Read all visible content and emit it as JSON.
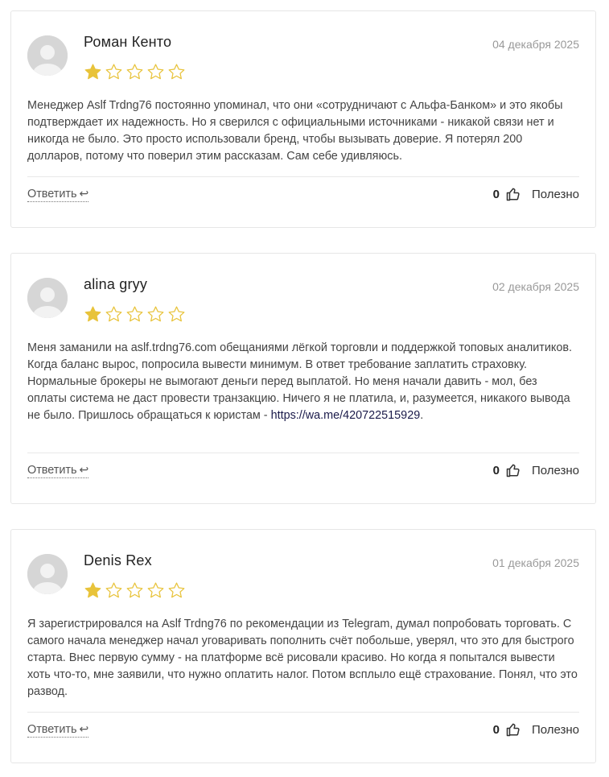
{
  "reviews": [
    {
      "author": "Роман Кенто",
      "date": "04 декабря 2025",
      "rating": 1,
      "max_rating": 5,
      "text": "Менеджер Aslf Trdng76 постоянно упоминал, что они «сотрудничают с Альфа-Банком» и это якобы подтверждает их надежность. Но я сверился с официальными источниками - никакой связи нет и никогда не было. Это просто использовали бренд, чтобы вызывать доверие. Я потерял 200 долларов, потому что поверил этим рассказам. Сам себе удивляюсь.",
      "reply_label": "Ответить",
      "likes": "0",
      "useful_label": "Полезно"
    },
    {
      "author": "alina gryy",
      "date": "02 декабря 2025",
      "rating": 1,
      "max_rating": 5,
      "text": "Меня заманили на aslf.trdng76.com обещаниями лёгкой торговли и поддержкой топовых аналитиков. Когда баланс вырос, попросила вывести минимум. В ответ требование заплатить страховку. Нормальные брокеры не вымогают деньги перед выплатой. Но меня начали давить - мол, без оплаты система не даст провести транзакцию. Ничего я не платила, и, разумеется, никакого вывода не было. Пришлось обращаться к юристам - ",
      "link_text": "https://wa.me/420722515929",
      "text_after_link": ".",
      "reply_label": "Ответить",
      "likes": "0",
      "useful_label": "Полезно"
    },
    {
      "author": "Denis Rex",
      "date": "01 декабря 2025",
      "rating": 1,
      "max_rating": 5,
      "text": "Я зарегистрировался на Aslf Trdng76 по рекомендации из Telegram, думал попробовать торговать. С самого начала менеджер начал уговаривать пополнить счёт побольше, уверял, что это для быстрого старта. Внес первую сумму - на платформе всё рисовали красиво. Но когда я попытался вывести хоть что-то, мне заявили, что нужно оплатить налог. Потом всплыло ещё страхование. Понял, что это развод.",
      "reply_label": "Ответить",
      "likes": "0",
      "useful_label": "Полезно"
    }
  ],
  "icons": {
    "reply": "reply-arrow-icon",
    "like": "thumbs-up-icon",
    "star_filled": "star-filled-icon",
    "star_empty": "star-empty-icon",
    "avatar": "user-avatar-icon"
  },
  "colors": {
    "star": "#e8c33a",
    "border": "#e6e6e6",
    "date": "#999999",
    "link": "#1a1a4a"
  }
}
